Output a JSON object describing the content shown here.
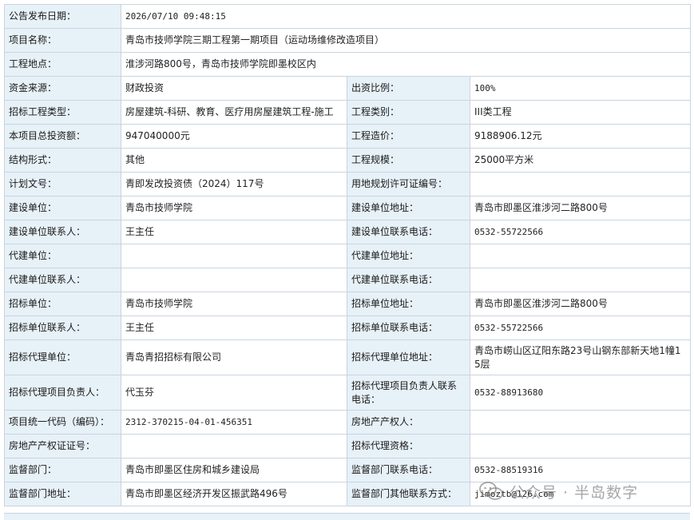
{
  "rows": [
    {
      "type": "wide",
      "label": "公告发布日期：",
      "value": "2026/07/10 09:48:15",
      "mono": true
    },
    {
      "type": "wide",
      "label": "项目名称：",
      "value": "青岛市技师学院三期工程第一期项目（运动场维修改造项目）"
    },
    {
      "type": "wide",
      "label": "工程地点：",
      "value": "淮涉河路800号，青岛市技师学院即墨校区内"
    },
    {
      "type": "pair",
      "label1": "资金来源：",
      "value1": "财政投资",
      "label2": "出资比例：",
      "value2": "100%"
    },
    {
      "type": "pair",
      "label1": "招标工程类型：",
      "value1": "房屋建筑-科研、教育、医疗用房屋建筑工程-施工",
      "label2": "工程类别：",
      "value2": "III类工程"
    },
    {
      "type": "pair",
      "label1": "本项目总投资额：",
      "value1": "947040000元",
      "label2": "工程造价：",
      "value2": "9188906.12元"
    },
    {
      "type": "pair",
      "label1": "结构形式：",
      "value1": "其他",
      "label2": "工程规模：",
      "value2": "25000平方米"
    },
    {
      "type": "pair",
      "label1": "计划文号：",
      "value1": "青即发改投资债（2024）117号",
      "label2": "用地规划许可证编号：",
      "value2": ""
    },
    {
      "type": "pair",
      "label1": "建设单位：",
      "value1": "青岛市技师学院",
      "label2": "建设单位地址：",
      "value2": "青岛市即墨区淮涉河二路800号"
    },
    {
      "type": "pair",
      "label1": "建设单位联系人：",
      "value1": "王主任",
      "label2": "建设单位联系电话：",
      "value2": "0532-55722566"
    },
    {
      "type": "pair",
      "label1": "代建单位：",
      "value1": "",
      "label2": "代建单位地址：",
      "value2": ""
    },
    {
      "type": "pair",
      "label1": "代建单位联系人：",
      "value1": "",
      "label2": "代建单位联系电话：",
      "value2": ""
    },
    {
      "type": "pair",
      "label1": "招标单位：",
      "value1": "青岛市技师学院",
      "label2": "招标单位地址：",
      "value2": "青岛市即墨区淮涉河二路800号"
    },
    {
      "type": "pair",
      "label1": "招标单位联系人：",
      "value1": "王主任",
      "label2": "招标单位联系电话：",
      "value2": "0532-55722566"
    },
    {
      "type": "pair",
      "tall": true,
      "label1": "招标代理单位：",
      "value1": "青岛青招招标有限公司",
      "label2": "招标代理单位地址：",
      "value2": "青岛市崂山区辽阳东路23号山钢东部新天地1幢15层"
    },
    {
      "type": "pair",
      "tall": true,
      "label1": "招标代理项目负责人：",
      "value1": "代玉芬",
      "label2": "招标代理项目负责人联系电话：",
      "value2": "0532-88913680"
    },
    {
      "type": "pair",
      "label1": "项目统一代码（编码）：",
      "value1": "2312-370215-04-01-456351",
      "label2": "房地产产权人：",
      "value2": ""
    },
    {
      "type": "pair",
      "label1": "房地产产权证证号：",
      "value1": "",
      "label2": "招标代理资格：",
      "value2": ""
    },
    {
      "type": "pair",
      "label1": "监督部门：",
      "value1": "青岛市即墨区住房和城乡建设局",
      "label2": "监督部门联系电话：",
      "value2": "0532-88519316"
    },
    {
      "type": "pair",
      "label1": "监督部门地址：",
      "value1": "青岛市即墨区经济开发区振武路496号",
      "label2": "监督部门其他联系方式：",
      "value2": "jimoztb@126.com"
    }
  ],
  "watermark": {
    "text": "公众号 · 半岛数字",
    "icon": "wechat-icon"
  },
  "colors": {
    "label_bg": "#e7f1f8",
    "border": "#c9d4de"
  }
}
